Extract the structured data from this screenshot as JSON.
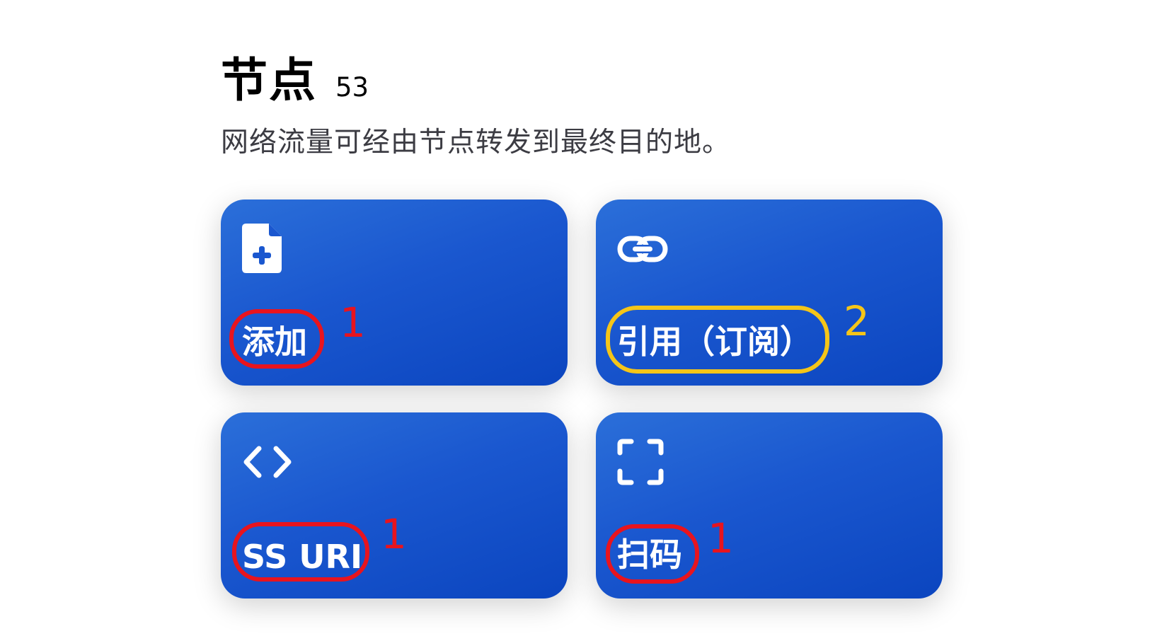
{
  "header": {
    "title": "节点",
    "count": "53",
    "subtitle": "网络流量可经由节点转发到最终目的地。"
  },
  "cards": [
    {
      "label": "添加",
      "icon": "file-plus-icon",
      "annotation": "1",
      "annotation_color": "#e8141e"
    },
    {
      "label": "引用（订阅）",
      "icon": "link-icon",
      "annotation": "2",
      "annotation_color": "#f5c518"
    },
    {
      "label": "SS URI",
      "icon": "code-brackets-icon",
      "annotation": "1",
      "annotation_color": "#e8141e"
    },
    {
      "label": "扫码",
      "icon": "scan-frame-icon",
      "annotation": "1",
      "annotation_color": "#e8141e"
    }
  ],
  "colors": {
    "card_blue": "#1a57cf",
    "annotation_red": "#e8141e",
    "annotation_yellow": "#f5c518"
  }
}
